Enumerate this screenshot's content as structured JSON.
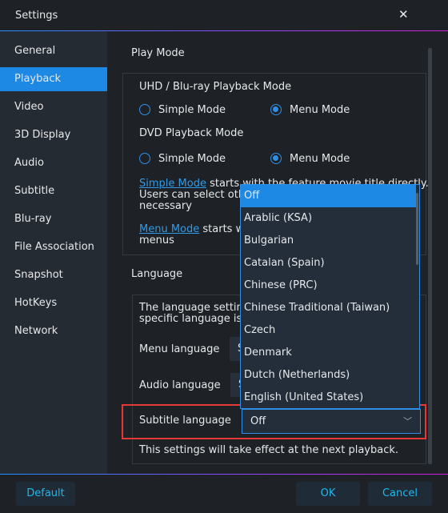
{
  "window": {
    "title": "Settings",
    "close_icon": "close-icon"
  },
  "sidebar": {
    "items": [
      {
        "label": "General"
      },
      {
        "label": "Playback",
        "active": true
      },
      {
        "label": "Video"
      },
      {
        "label": "3D Display"
      },
      {
        "label": "Audio"
      },
      {
        "label": "Subtitle"
      },
      {
        "label": "Blu-ray"
      },
      {
        "label": "File Association"
      },
      {
        "label": "Snapshot"
      },
      {
        "label": "HotKeys"
      },
      {
        "label": "Network"
      }
    ]
  },
  "play_mode": {
    "heading": "Play Mode",
    "uhd_label": "UHD / Blu-ray Playback Mode",
    "uhd_simple": "Simple Mode",
    "uhd_menu": "Menu Mode",
    "uhd_selected": "Menu Mode",
    "dvd_label": "DVD Playback Mode",
    "dvd_simple": "Simple Mode",
    "dvd_menu": "Menu Mode",
    "dvd_selected": "Menu Mode",
    "simple_link": "Simple Mode",
    "simple_desc1": " starts with the feature movie title directly.",
    "simple_desc2": "Users can select oth",
    "simple_desc3": "necessary",
    "menu_link": "Menu Mode",
    "menu_desc1": " starts w",
    "menu_desc2": "menus"
  },
  "language": {
    "heading": "Language",
    "desc1": "The language settin",
    "desc2": "specific language is",
    "menu_label": "Menu language",
    "menu_value": "S",
    "audio_label": "Audio language",
    "audio_value": "S",
    "subtitle_label": "Subtitle language",
    "subtitle_value": "Off",
    "note": "This settings will take effect at the next playback."
  },
  "dropdown": {
    "options": [
      "Off",
      "Arablic (KSA)",
      "Bulgarian",
      "Catalan (Spain)",
      "Chinese (PRC)",
      "Chinese Traditional (Taiwan)",
      "Czech",
      "Denmark",
      "Dutch (Netherlands)",
      "English (United States)"
    ],
    "selected": "Off"
  },
  "footer": {
    "default_label": "Default",
    "ok_label": "OK",
    "cancel_label": "Cancel"
  },
  "colors": {
    "accent": "#1e88e5",
    "highlight": "#e53935",
    "button_text": "#1fb8ef"
  }
}
